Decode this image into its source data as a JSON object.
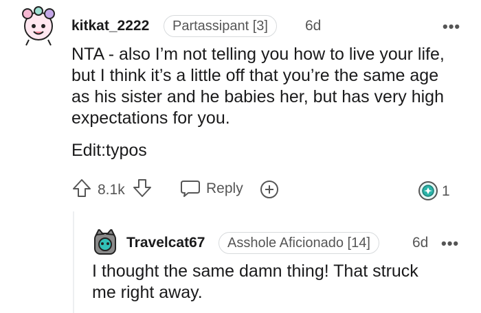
{
  "comment": {
    "username": "kitkat_2222",
    "flair": "Partassipant [3]",
    "age": "6d",
    "more": "•••",
    "body": [
      "NTA - also I’m not telling you how to live your life,",
      "but I think it’s a little off that you’re the same age",
      "as his sister and he babies her, but has very high",
      "expectations for you."
    ],
    "edit": "Edit:typos",
    "votes": "8.1k",
    "reply_label": "Reply",
    "award_count": "1"
  },
  "reply": {
    "username": "Travelcat67",
    "flair": "Asshole Aficionado [14]",
    "age": "6d",
    "more": "•••",
    "body": [
      "I thought the same damn thing! That struck",
      "me right away."
    ]
  },
  "colors": {
    "text": "#1a1a1b",
    "muted": "#555555",
    "border": "#d7dadc",
    "award_teal": "#2ab3a8"
  },
  "icons": {
    "upvote": "arrow-up-icon",
    "downvote": "arrow-down-icon",
    "reply": "speech-bubble-icon",
    "award": "plus-circle-icon",
    "badge": "award-badge-icon",
    "more": "ellipsis-icon"
  }
}
